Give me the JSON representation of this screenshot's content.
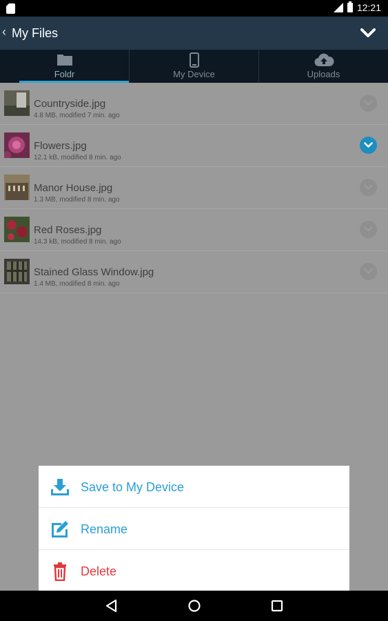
{
  "status_bar": {
    "time": "12:21"
  },
  "app_bar": {
    "title": "My Files"
  },
  "tabs": [
    {
      "label": "Foldr",
      "icon": "folder-icon",
      "active": true
    },
    {
      "label": "My Device",
      "icon": "phone-icon",
      "active": false
    },
    {
      "label": "Uploads",
      "icon": "cloud-upload-icon",
      "active": false
    }
  ],
  "files": [
    {
      "name": "Countryside.jpg",
      "meta": "4.8 MB, modified 7 min. ago",
      "selected": false
    },
    {
      "name": "Flowers.jpg",
      "meta": "12.1 kB, modified 8 min. ago",
      "selected": true
    },
    {
      "name": "Manor House.jpg",
      "meta": "1.3 MB, modified 8 min. ago",
      "selected": false
    },
    {
      "name": "Red Roses.jpg",
      "meta": "14.3 kB, modified 8 min. ago",
      "selected": false
    },
    {
      "name": "Stained Glass Window.jpg",
      "meta": "1.4 MB, modified 8 min. ago",
      "selected": false
    }
  ],
  "action_sheet": {
    "items": [
      {
        "label": "Save to My Device",
        "icon": "download-icon"
      },
      {
        "label": "Rename",
        "icon": "edit-icon"
      },
      {
        "label": "Delete",
        "icon": "trash-icon"
      }
    ]
  },
  "colors": {
    "app_bar": "#24384a",
    "tab_bar": "#0d1822",
    "accent": "#2fa3d6",
    "danger": "#e0383e"
  }
}
